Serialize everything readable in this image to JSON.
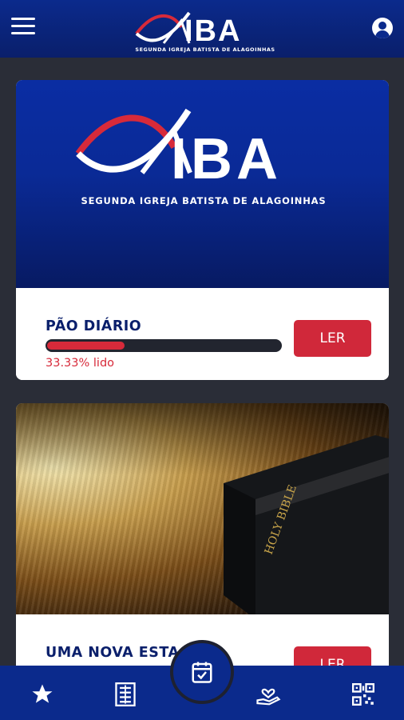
{
  "header": {
    "logo_text": "IBA",
    "logo_subtitle": "SEGUNDA IGREJA BATISTA DE ALAGOINHAS",
    "menu_icon": "menu-icon",
    "profile_icon": "account-circle-icon"
  },
  "cards": [
    {
      "banner_logo_text": "IBA",
      "banner_logo_subtitle": "SEGUNDA IGREJA BATISTA DE ALAGOINHAS",
      "title": "PÃO DIÁRIO",
      "progress": 0.3333,
      "progress_text": "33.33% lido",
      "button_label": "LER"
    },
    {
      "title": "UMA NOVA ESTAÇÃO",
      "button_label": "LER",
      "image_text": "HOLY BIBLE"
    }
  ],
  "bottom_nav": {
    "items": [
      {
        "icon": "star-icon"
      },
      {
        "icon": "book-list-icon"
      },
      {
        "icon": "calendar-check-icon"
      },
      {
        "icon": "hand-heart-icon"
      },
      {
        "icon": "qr-code-icon"
      }
    ]
  },
  "colors": {
    "primary": "#0b2a8c",
    "accent": "#d0283a",
    "background": "#2a2d37",
    "title_text": "#0a1f6b"
  }
}
